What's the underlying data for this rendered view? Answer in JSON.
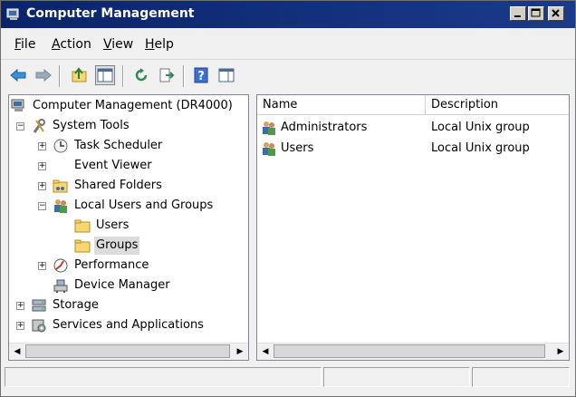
{
  "window": {
    "title": "Computer Management"
  },
  "menu": [
    {
      "label": "File",
      "mnemonic": "F",
      "rest": "ile"
    },
    {
      "label": "Action",
      "mnemonic": "A",
      "rest": "ction"
    },
    {
      "label": "View",
      "mnemonic": "V",
      "rest": "iew"
    },
    {
      "label": "Help",
      "mnemonic": "H",
      "rest": "elp"
    }
  ],
  "toolbar": {
    "icons": [
      "back-icon",
      "forward-icon",
      "up-folder-icon",
      "show-hide-tree-icon",
      "refresh-icon",
      "export-list-icon",
      "help-icon",
      "show-hide-action-pane-icon"
    ]
  },
  "tree": {
    "root": "Computer Management (DR4000)",
    "items": [
      {
        "label": "System Tools",
        "icon": "tools-icon",
        "expander": "−"
      },
      {
        "label": "Task Scheduler",
        "icon": "clock-icon",
        "expander": "+"
      },
      {
        "label": "Event Viewer",
        "icon": "event-viewer-icon",
        "expander": "+"
      },
      {
        "label": "Shared Folders",
        "icon": "shared-folder-icon",
        "expander": "+"
      },
      {
        "label": "Local Users and Groups",
        "icon": "users-groups-icon",
        "expander": "−"
      },
      {
        "label": "Users",
        "icon": "folder-icon",
        "expander": ""
      },
      {
        "label": "Groups",
        "icon": "folder-icon",
        "expander": ""
      },
      {
        "label": "Performance",
        "icon": "performance-icon",
        "expander": "+"
      },
      {
        "label": "Device Manager",
        "icon": "device-manager-icon",
        "expander": ""
      },
      {
        "label": "Storage",
        "icon": "storage-icon",
        "expander": "+"
      },
      {
        "label": "Services and Applications",
        "icon": "services-icon",
        "expander": "+"
      }
    ]
  },
  "list": {
    "columns": [
      "Name",
      "Description"
    ],
    "rows": [
      {
        "name": "Administrators",
        "description": "Local Unix group"
      },
      {
        "name": "Users",
        "description": "Local Unix group"
      }
    ]
  },
  "colors": {
    "titlebar": "#0a246a",
    "selection": "#dcdcdc",
    "folder": "#f7d774"
  }
}
